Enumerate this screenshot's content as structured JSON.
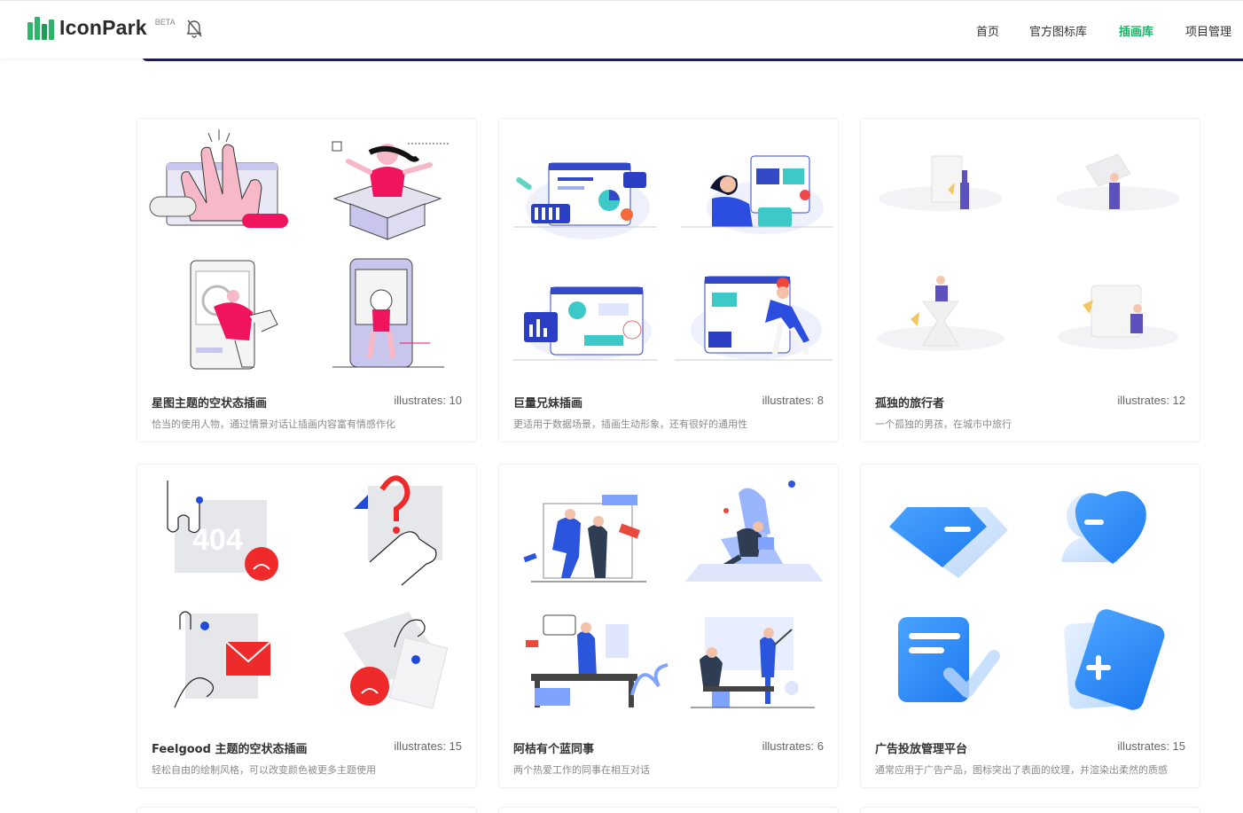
{
  "header": {
    "logo_text": "IconPark",
    "beta": "BETA",
    "nav": [
      "首页",
      "官方图标库",
      "插画库",
      "项目管理"
    ],
    "active_nav": "插画库",
    "accent": "#1fb067"
  },
  "cards": [
    {
      "title": "星图主题的空状态插画",
      "count": "illustrates: 10",
      "desc": "恰当的使用人物，通过情景对话让插画内容富有情感作化"
    },
    {
      "title": "巨量兄妹插画",
      "count": "illustrates: 8",
      "desc": "更适用于数据场景，插画生动形象，还有很好的通用性"
    },
    {
      "title": "孤独的旅行者",
      "count": "illustrates: 12",
      "desc": "一个孤独的男孩，在城市中旅行"
    },
    {
      "title": "Feelgood 主题的空状态插画",
      "count": "illustrates: 15",
      "desc": "轻松自由的绘制风格，可以改变颜色被更多主题使用"
    },
    {
      "title": "阿桔有个蓝同事",
      "count": "illustrates: 6",
      "desc": "两个热爱工作的同事在相互对话"
    },
    {
      "title": "广告投放管理平台",
      "count": "illustrates: 15",
      "desc": "通常应用于广告产品，图标突出了表面的纹理，并渲染出柔然的质感"
    }
  ],
  "illustration_labels": {
    "error_404": "404"
  },
  "colors": {
    "pink": "#f0135e",
    "blue": "#2b4de0",
    "purple": "#4b3fb8",
    "light_blue": "#3a8ef6"
  }
}
